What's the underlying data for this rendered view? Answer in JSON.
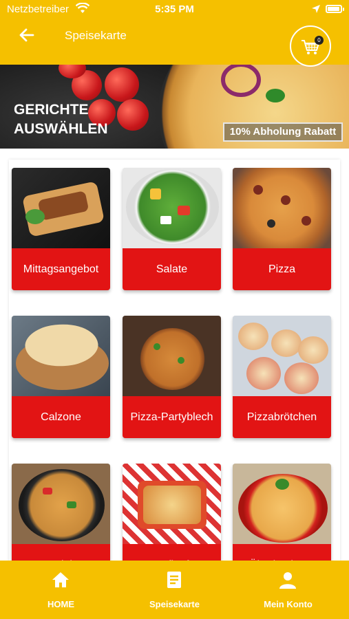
{
  "status_bar": {
    "carrier": "Netzbetreiber",
    "time": "5:35 PM",
    "wifi_icon": "wifi-icon",
    "location_icon": "location-arrow-icon",
    "battery_icon": "battery-icon"
  },
  "header": {
    "title": "Speisekarte",
    "back_icon": "arrow-left-icon",
    "cart_icon": "shopping-cart-icon",
    "cart_count": "0",
    "background_color": "#f5c000"
  },
  "banner": {
    "heading": "GERICHTE AUSWÄHLEN",
    "promo": "10% Abholung Rabatt"
  },
  "categories": [
    {
      "label": "Mittagsangebot"
    },
    {
      "label": "Salate"
    },
    {
      "label": "Pizza"
    },
    {
      "label": "Calzone"
    },
    {
      "label": "Pizza-Partyblech"
    },
    {
      "label": "Pizzabrötchen"
    },
    {
      "label": "Nudeln"
    },
    {
      "label": "Auflauf"
    },
    {
      "label": "Überbackene"
    }
  ],
  "tabbar": {
    "items": [
      {
        "label": "HOME",
        "icon": "home-icon"
      },
      {
        "label": "Speisekarte",
        "icon": "menu-list-icon"
      },
      {
        "label": "Mein Konto",
        "icon": "user-icon"
      }
    ]
  },
  "colors": {
    "accent": "#f5c000",
    "tile_label": "#e21414"
  }
}
